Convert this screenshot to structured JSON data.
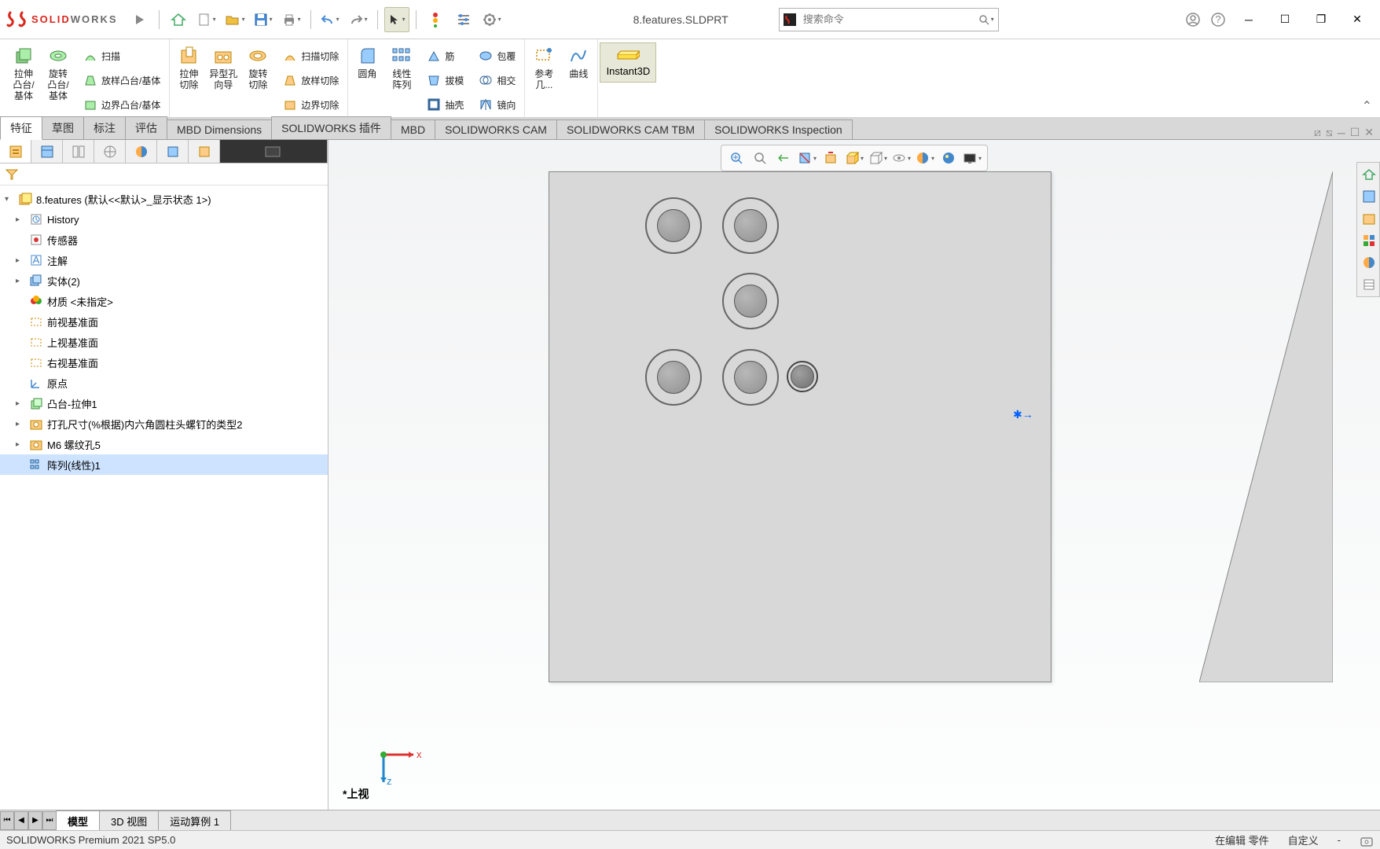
{
  "app": {
    "name_solid": "SOLID",
    "name_works": "WORKS"
  },
  "title": "8.features.SLDPRT",
  "search": {
    "placeholder": "搜索命令"
  },
  "ribbon": {
    "extrude": "拉伸\n凸台/\n基体",
    "revolve": "旋转\n凸台/\n基体",
    "sweep": "扫描",
    "loft": "放样凸台/基体",
    "boundary": "边界凸台/基体",
    "cut_ext": "拉伸\n切除",
    "hole": "异型孔\n向导",
    "cut_rev": "旋转\n切除",
    "cut_sweep": "扫描切除",
    "cut_loft": "放样切除",
    "cut_bound": "边界切除",
    "fillet": "圆角",
    "pattern": "线性\n阵列",
    "rib": "筋",
    "draft": "拔模",
    "shell": "抽壳",
    "wrap": "包覆",
    "intersect": "相交",
    "mirror": "镜向",
    "refgeo": "参考\n几...",
    "curves": "曲线",
    "instant3d": "Instant3D"
  },
  "tabs": [
    "特征",
    "草图",
    "标注",
    "评估",
    "MBD Dimensions",
    "SOLIDWORKS 插件",
    "MBD",
    "SOLIDWORKS CAM",
    "SOLIDWORKS CAM TBM",
    "SOLIDWORKS Inspection"
  ],
  "tree": {
    "root": "8.features  (默认<<默认>_显示状态 1>)",
    "items": [
      {
        "label": "History",
        "indent": 1,
        "arrow": true,
        "icon": "hist"
      },
      {
        "label": "传感器",
        "indent": 1,
        "arrow": false,
        "icon": "sensor"
      },
      {
        "label": "注解",
        "indent": 1,
        "arrow": true,
        "icon": "annot"
      },
      {
        "label": "实体(2)",
        "indent": 1,
        "arrow": true,
        "icon": "solid"
      },
      {
        "label": "材质 <未指定>",
        "indent": 1,
        "arrow": false,
        "icon": "mat"
      },
      {
        "label": "前视基准面",
        "indent": 1,
        "arrow": false,
        "icon": "plane"
      },
      {
        "label": "上视基准面",
        "indent": 1,
        "arrow": false,
        "icon": "plane"
      },
      {
        "label": "右视基准面",
        "indent": 1,
        "arrow": false,
        "icon": "plane"
      },
      {
        "label": "原点",
        "indent": 1,
        "arrow": false,
        "icon": "origin"
      },
      {
        "label": "凸台-拉伸1",
        "indent": 1,
        "arrow": true,
        "icon": "feat"
      },
      {
        "label": "打孔尺寸(%根据)内六角圆柱头螺钉的类型2",
        "indent": 1,
        "arrow": true,
        "icon": "hole"
      },
      {
        "label": "M6 螺纹孔5",
        "indent": 1,
        "arrow": true,
        "icon": "hole"
      },
      {
        "label": "阵列(线性)1",
        "indent": 1,
        "arrow": false,
        "icon": "pat",
        "sel": true
      }
    ]
  },
  "bottom_tabs": [
    "模型",
    "3D 视图",
    "运动算例 1"
  ],
  "view_label": "*上视",
  "axes": {
    "x": "x",
    "z": "z"
  },
  "status": {
    "left": "SOLIDWORKS Premium 2021 SP5.0",
    "edit": "在编辑 零件",
    "custom": "自定义",
    "dash": "-"
  }
}
